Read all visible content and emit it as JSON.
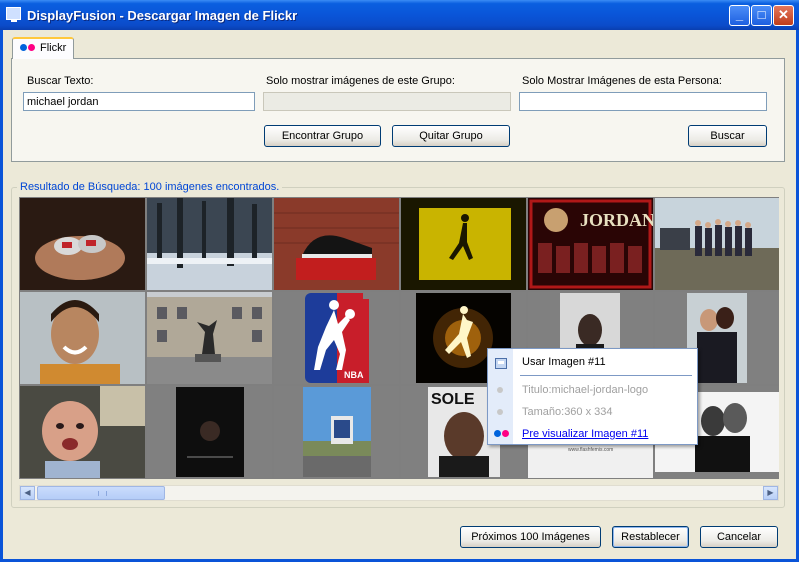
{
  "window": {
    "title": "DisplayFusion - Descargar Imagen de Flickr",
    "minimize": "_",
    "maximize": "□",
    "close": "✕"
  },
  "tab": {
    "label": "Flickr",
    "icon": "flickr-icon"
  },
  "search": {
    "text_label": "Buscar Texto:",
    "text_value": "michael jordan",
    "group_label": "Solo mostrar imágenes de este Grupo:",
    "group_value": "",
    "person_label": "Solo Mostrar Imágenes de esta Persona:",
    "person_value": "",
    "find_group_button": "Encontrar Grupo",
    "remove_group_button": "Quitar Grupo",
    "search_button": "Buscar"
  },
  "results": {
    "label": "Resultado de Búsqueda: 100 imágenes encontrados.",
    "thumbnails": [
      {
        "name": "thumb-hands-sneakers"
      },
      {
        "name": "thumb-snowy-forest"
      },
      {
        "name": "thumb-red-sneaker-box"
      },
      {
        "name": "thumb-jumpman-yellow"
      },
      {
        "name": "thumb-jordan-collage"
      },
      {
        "name": "thumb-group-photo"
      },
      {
        "name": "thumb-smiling-man"
      },
      {
        "name": "thumb-statue-building"
      },
      {
        "name": "thumb-nba-logo"
      },
      {
        "name": "thumb-jumpman-glow"
      },
      {
        "name": "thumb-woman-portrait"
      },
      {
        "name": "thumb-couple"
      },
      {
        "name": "thumb-baby"
      },
      {
        "name": "thumb-dark-poster"
      },
      {
        "name": "thumb-road-sky"
      },
      {
        "name": "thumb-sole-magazine"
      },
      {
        "name": "thumb-white-photo"
      },
      {
        "name": "thumb-bw-couple"
      }
    ],
    "scroll_left": "◀",
    "scroll_right": "▶"
  },
  "context_menu": {
    "use_image": "Usar Imagen #11",
    "title": "Titulo:michael-jordan-logo",
    "size": "Tamaño:360 x 334",
    "preview": "Pre visualizar Imagen #11"
  },
  "footer": {
    "next_button": "Próximos 100 Imágenes",
    "reset_button": "Restablecer",
    "cancel_button": "Cancelar"
  },
  "colors": {
    "titlebar": "#0a55d8",
    "group_label": "#0046d5",
    "menu_border": "#7d99c5"
  }
}
